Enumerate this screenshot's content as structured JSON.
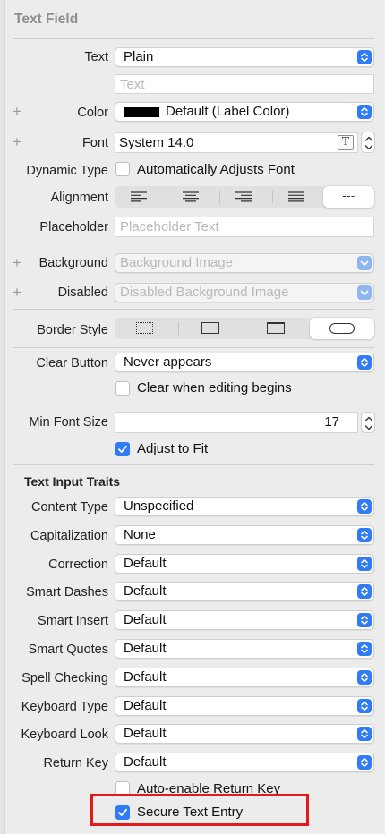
{
  "section_title": "Text Field",
  "text": {
    "label": "Text",
    "value": "Plain",
    "field_placeholder": "Text"
  },
  "color": {
    "label": "Color",
    "value": "Default (Label Color)",
    "swatch": "#000000"
  },
  "font": {
    "label": "Font",
    "value": "System 14.0",
    "button_glyph": "T"
  },
  "dynamic_type": {
    "label": "Dynamic Type",
    "checkbox_label": "Automatically Adjusts Font",
    "checked": false
  },
  "alignment": {
    "label": "Alignment",
    "options": [
      "left",
      "center",
      "right",
      "justified",
      "natural"
    ],
    "natural_glyph": "---",
    "selected": "natural"
  },
  "placeholder": {
    "label": "Placeholder",
    "field_placeholder": "Placeholder Text"
  },
  "background": {
    "label": "Background",
    "value": "Background Image"
  },
  "disabled": {
    "label": "Disabled",
    "value": "Disabled Background Image"
  },
  "border_style": {
    "label": "Border Style",
    "options": [
      "none",
      "line",
      "bezel",
      "rounded-rect"
    ],
    "selected": "rounded-rect"
  },
  "clear_button": {
    "label": "Clear Button",
    "value": "Never appears",
    "checkbox_label": "Clear when editing begins",
    "checked": false
  },
  "min_font_size": {
    "label": "Min Font Size",
    "value": "17",
    "checkbox_label": "Adjust to Fit",
    "checked": true
  },
  "text_input_traits": {
    "title": "Text Input Traits",
    "rows": [
      {
        "label": "Content Type",
        "value": "Unspecified"
      },
      {
        "label": "Capitalization",
        "value": "None"
      },
      {
        "label": "Correction",
        "value": "Default"
      },
      {
        "label": "Smart Dashes",
        "value": "Default"
      },
      {
        "label": "Smart Insert",
        "value": "Default"
      },
      {
        "label": "Smart Quotes",
        "value": "Default"
      },
      {
        "label": "Spell Checking",
        "value": "Default"
      },
      {
        "label": "Keyboard Type",
        "value": "Default"
      },
      {
        "label": "Keyboard Look",
        "value": "Default"
      },
      {
        "label": "Return Key",
        "value": "Default"
      }
    ],
    "auto_enable": {
      "label": "Auto-enable Return Key",
      "checked": false
    },
    "secure_entry": {
      "label": "Secure Text Entry",
      "checked": true
    }
  },
  "colors": {
    "accent": "#2f7cf6",
    "highlight": "#e3191b"
  }
}
